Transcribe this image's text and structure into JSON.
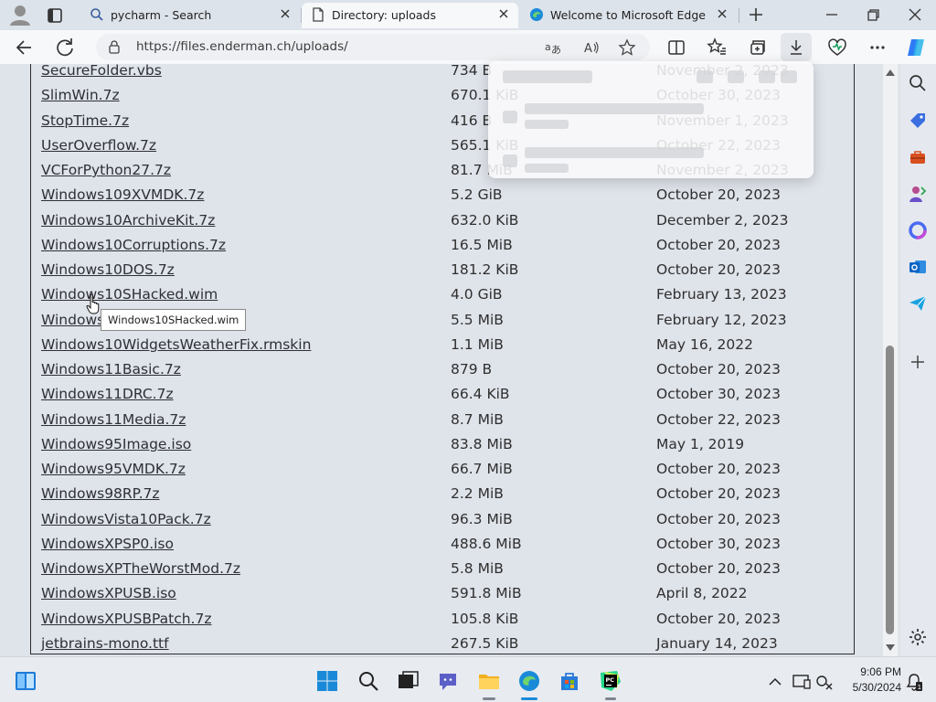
{
  "browser": {
    "tabs": [
      {
        "title": "pycharm - Search",
        "active": false
      },
      {
        "title": "Directory: uploads",
        "active": true
      },
      {
        "title": "Welcome to Microsoft Edge",
        "active": false
      }
    ],
    "url": "https://files.enderman.ch/uploads/"
  },
  "listing": {
    "rows": [
      {
        "name": "SecureFolder.vbs",
        "size": "734 B",
        "date": "November 2, 2023"
      },
      {
        "name": "SlimWin.7z",
        "size": "670.1 KiB",
        "date": "October 30, 2023"
      },
      {
        "name": "StopTime.7z",
        "size": "416 B",
        "date": "November 1, 2023"
      },
      {
        "name": "UserOverflow.7z",
        "size": "565.1 KiB",
        "date": "October 22, 2023"
      },
      {
        "name": "VCForPython27.7z",
        "size": "81.7 MiB",
        "date": "November 2, 2023"
      },
      {
        "name": "Windows109XVMDK.7z",
        "size": "5.2 GiB",
        "date": "October 20, 2023"
      },
      {
        "name": "Windows10ArchiveKit.7z",
        "size": "632.0 KiB",
        "date": "December 2, 2023"
      },
      {
        "name": "Windows10Corruptions.7z",
        "size": "16.5 MiB",
        "date": "October 20, 2023"
      },
      {
        "name": "Windows10DOS.7z",
        "size": "181.2 KiB",
        "date": "October 20, 2023"
      },
      {
        "name": "Windows10SHacked.wim",
        "size": "4.0 GiB",
        "date": "February 13, 2023"
      },
      {
        "name": "Windows10ShellExperience",
        "size": "5.5 MiB",
        "date": "February 12, 2023"
      },
      {
        "name": "Windows10WidgetsWeatherFix.rmskin",
        "size": "1.1 MiB",
        "date": "May 16, 2022"
      },
      {
        "name": "Windows11Basic.7z",
        "size": "879 B",
        "date": "October 20, 2023"
      },
      {
        "name": "Windows11DRC.7z",
        "size": "66.4 KiB",
        "date": "October 30, 2023"
      },
      {
        "name": "Windows11Media.7z",
        "size": "8.7 MiB",
        "date": "October 22, 2023"
      },
      {
        "name": "Windows95Image.iso",
        "size": "83.8 MiB",
        "date": "May 1, 2019"
      },
      {
        "name": "Windows95VMDK.7z",
        "size": "66.7 MiB",
        "date": "October 20, 2023"
      },
      {
        "name": "Windows98RP.7z",
        "size": "2.2 MiB",
        "date": "October 20, 2023"
      },
      {
        "name": "WindowsVista10Pack.7z",
        "size": "96.3 MiB",
        "date": "October 20, 2023"
      },
      {
        "name": "WindowsXPSP0.iso",
        "size": "488.6 MiB",
        "date": "October 30, 2023"
      },
      {
        "name": "WindowsXPTheWorstMod.7z",
        "size": "5.8 MiB",
        "date": "October 20, 2023"
      },
      {
        "name": "WindowsXPUSB.iso",
        "size": "591.8 MiB",
        "date": "April 8, 2022"
      },
      {
        "name": "WindowsXPUSBPatch.7z",
        "size": "105.8 KiB",
        "date": "October 20, 2023"
      },
      {
        "name": "jetbrains-mono.ttf",
        "size": "267.5 KiB",
        "date": "January 14, 2023"
      }
    ]
  },
  "tooltip": "Windows10SHacked.wim",
  "taskbar": {
    "time": "9:06 PM",
    "date": "5/30/2024"
  },
  "colors": {
    "page_bg": "#dfe3ea",
    "link": "#2e3036",
    "edge_blue": "#1a8ad8",
    "copilot": "#2f7bf5"
  }
}
